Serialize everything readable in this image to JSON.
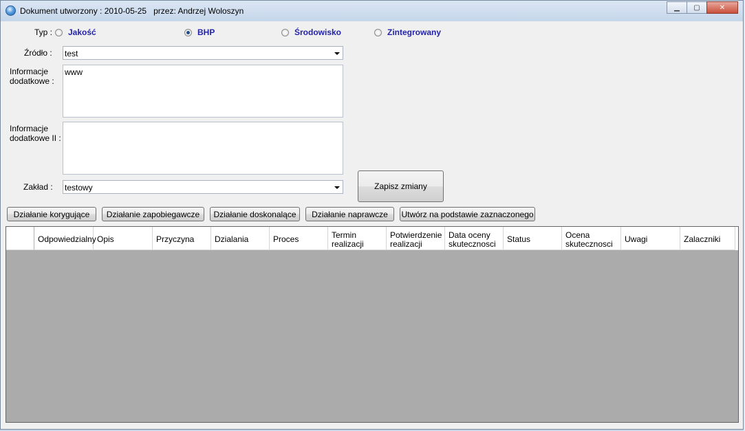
{
  "window": {
    "title": "Dokument utworzony : 2010-05-25   przez: Andrzej Woloszyn",
    "minimize_glyph": "▁",
    "maximize_glyph": "▢",
    "close_glyph": "✕"
  },
  "form": {
    "type_label": "Typ :",
    "type_options": [
      {
        "label": "Jakość",
        "checked": false
      },
      {
        "label": "BHP",
        "checked": true
      },
      {
        "label": "Środowisko",
        "checked": false
      },
      {
        "label": "Zintegrowany",
        "checked": false
      }
    ],
    "source_label": "Źródło :",
    "source_value": "test",
    "info_label": "Informacje\ndodatkowe :",
    "info_value": "www",
    "info2_label": "Informacje\ndodatkowe II :",
    "info2_value": "",
    "plant_label": "Zakład :",
    "plant_value": "testowy",
    "save_button": "Zapisz zmiany"
  },
  "actions": [
    "Działanie korygujące",
    "Działanie zapobiegawcze",
    "Działanie doskonalące",
    "Działanie naprawcze",
    "Utwórz na podstawie zaznaczonego"
  ],
  "grid": {
    "columns": [
      "Odpowiedzialny",
      "Opis",
      "Przyczyna",
      "Dzialania",
      "Proces",
      "Termin\nrealizacji",
      "Potwierdzenie\nrealizacji",
      "Data oceny\nskutecznosci",
      "Status",
      "Ocena\nskutecznosci",
      "Uwagi",
      "Zalaczniki"
    ]
  }
}
